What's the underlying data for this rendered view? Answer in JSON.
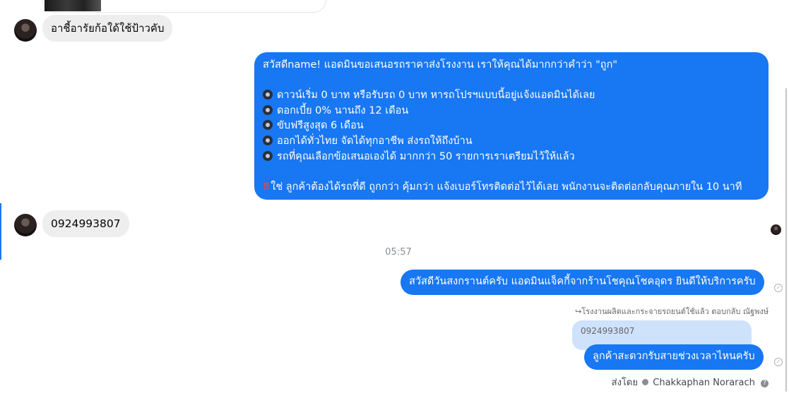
{
  "conversation": {
    "incoming_1": "อาชี้อารัยก้อใด้ใช้ป้าวคับ",
    "outgoing_offer": {
      "intro": "สวัสดีname! แอดมินขอเสนอรถราคาส่งโรงงาน เราให้คุณได้มากกว่าคำว่า \"ถูก\"",
      "bullets": [
        "ดาวน์เริ่ม 0 บาท หรือรับรถ 0 บาท หารถโปรฯแบบนี้อยู่แจ้งแอดมินได้เลย",
        "ดอกเบี้ย 0% นานถึง 12 เดือน",
        "ขับฟรีสูงสุด 6 เดือน",
        "ออกได้ทั่วไทย จัดได้ทุกอาชีพ ส่งรถให้ถึงบ้าน",
        "รถที่คุณเลือกข้อเสนอเองได้ มากกว่า 50 รายการเราเตรียมไว้ให้แล้ว"
      ],
      "closing": "ใช่ ลูกค้าต้องได้รถที่ดี ถูกกว่า คุ้มกว่า แจ้งเบอร์โทรติดต่อไว้ได้เลย พนักงานจะติดต่อกลับคุณภายใน 10 นาที",
      "bullet_icon": "gear-emoji-icon",
      "closing_icon": "double-exclamation-icon"
    },
    "incoming_2": "0924993807",
    "timestamp": "05:57",
    "outgoing_greeting": "สวัสดีวันสงกรานต์ครับ แอดมินแจ็คกี้จากร้านโชคุณโชคอุดร ยินดีให้บริการครับ",
    "reply_meta": "โรงงานผลิตและกระจายรถยนต์ใช้แล้ว ตอบกลับ ณัฐพงษ์",
    "quoted_text": "0924993807",
    "outgoing_reply": "ลูกค้าสะดวกรับสายช่วงเวลาไหนครับ",
    "sent_by_label": "ส่งโดย",
    "sender_name": "Chakkaphan Norarach",
    "help_glyph": "?"
  },
  "colors": {
    "outgoing_bubble": "#1877f2",
    "incoming_bubble": "#eeeeee",
    "quoted_bubble": "#cfe2fb"
  }
}
